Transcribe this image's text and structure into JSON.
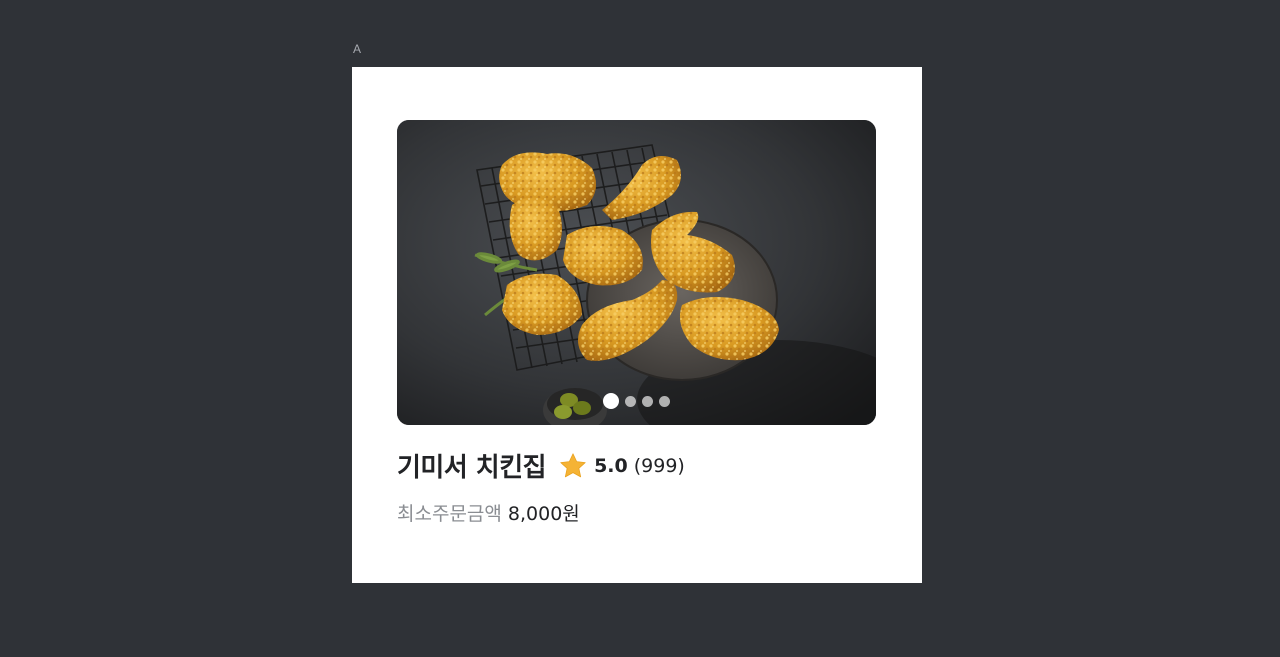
{
  "frame": {
    "label": "A"
  },
  "card": {
    "image": {
      "alt": "fried chicken on rack and plate",
      "icon": "food-photo"
    },
    "carousel": {
      "total": 4,
      "active_index": 0
    },
    "store_name": "기미서 치킨집",
    "rating_icon": "star-icon",
    "rating": "5.0",
    "review_count": "(999)",
    "min_order_label": "최소주문금액",
    "min_order_value": "8,000원"
  },
  "colors": {
    "background": "#2f3237",
    "card": "#ffffff",
    "star": "#f5b335",
    "title": "#222326",
    "muted": "#8a8d92"
  }
}
